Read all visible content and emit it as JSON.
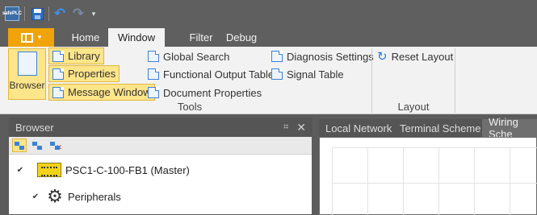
{
  "quick_access": {
    "app_logo_text": "safePLC",
    "icons": [
      "save-icon",
      "undo-icon",
      "redo-icon",
      "customize-menu-icon"
    ]
  },
  "ribbon_tabs": [
    "Home",
    "Window",
    "Filter",
    "Debug"
  ],
  "active_tab": "Window",
  "ribbon": {
    "browser_label": "Browser",
    "library_label": "Library",
    "properties_label": "Properties",
    "message_window_label": "Message Window",
    "global_search_label": "Global Search",
    "functional_output_table_label": "Functional Output Table",
    "document_properties_label": "Document Properties",
    "diagnosis_settings_label": "Diagnosis Settings",
    "signal_table_label": "Signal Table",
    "reset_layout_label": "Reset Layout",
    "tools_group_label": "Tools",
    "layout_group_label": "Layout"
  },
  "browser_panel": {
    "title": "Browser",
    "pin_glyph": "⌗",
    "close_glyph": "✕",
    "tree": {
      "device_label": "PSC1-C-100-FB1 (Master)",
      "peripherals_label": "Peripherals"
    }
  },
  "document_tabs": [
    "Local Network",
    "Terminal Scheme",
    "Wiring Sche"
  ],
  "active_document_tab": "Wiring Sche",
  "colors": {
    "accent_orange": "#f0a30a",
    "highlight_yellow": "#fde58a",
    "dark_chrome": "#5f5f5f"
  }
}
